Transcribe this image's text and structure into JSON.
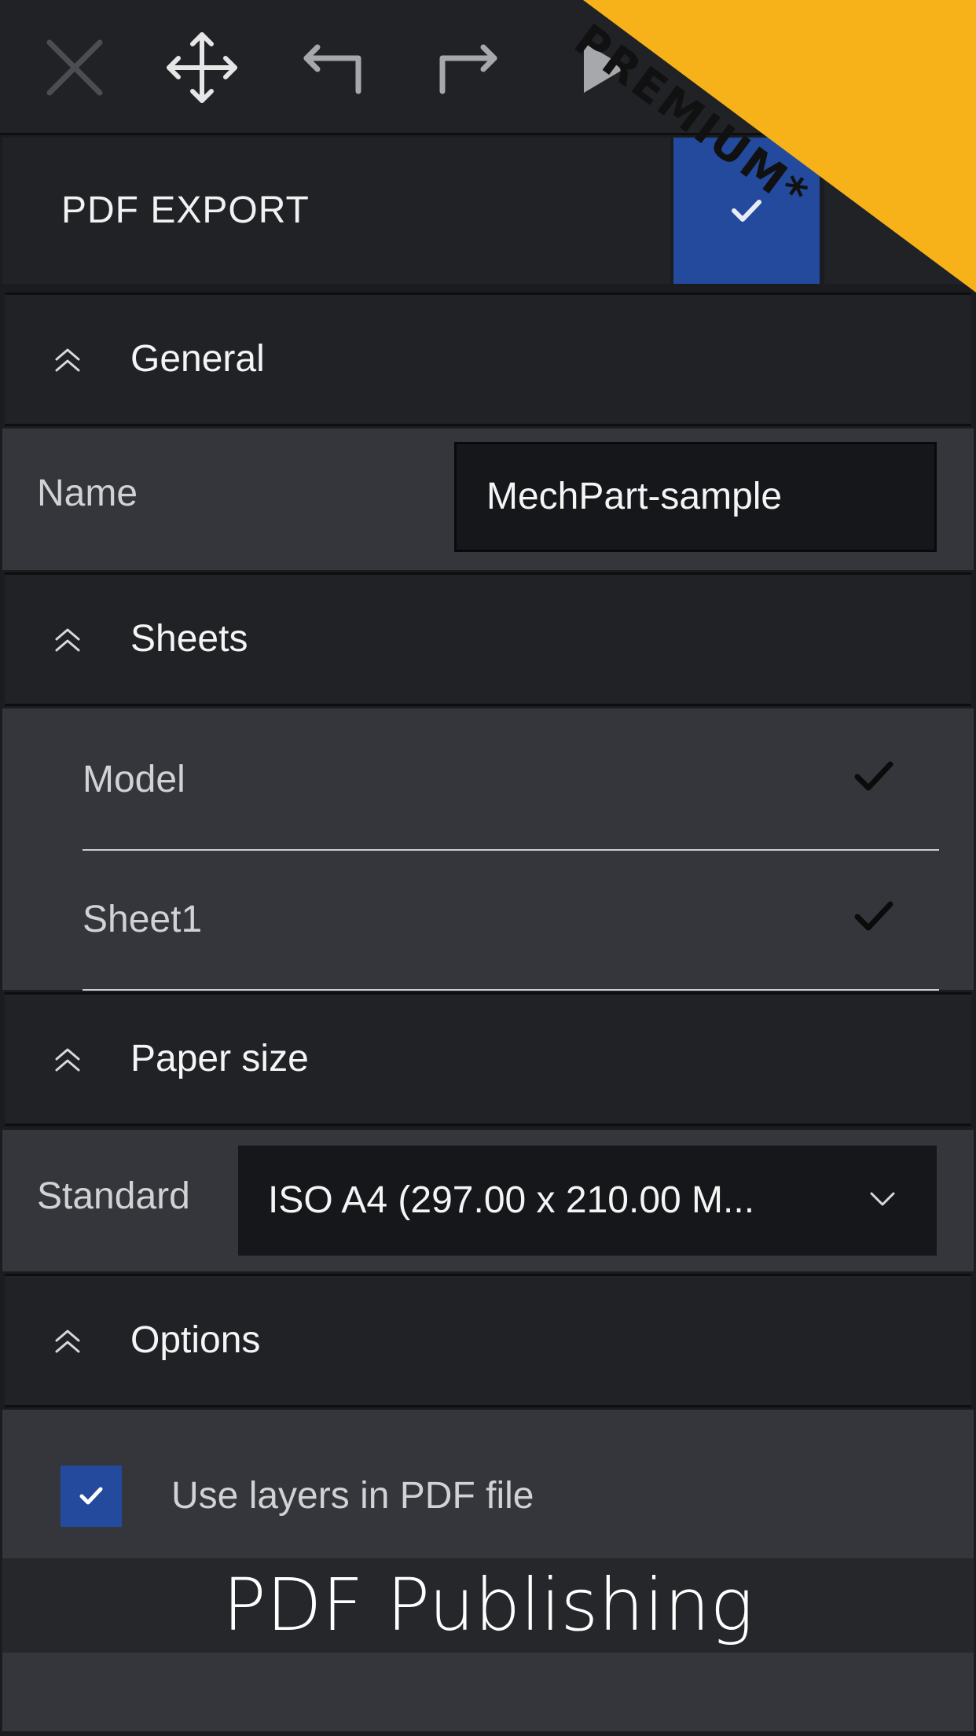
{
  "toolbar": {
    "icons": [
      "close-icon",
      "move-icon",
      "undo-icon",
      "redo-icon",
      "play-icon"
    ]
  },
  "ribbon": {
    "text": "PREMIUM*",
    "color": "#f7b21a"
  },
  "header": {
    "title": "PDF EXPORT"
  },
  "sections": {
    "general": {
      "label": "General"
    },
    "sheets": {
      "label": "Sheets"
    },
    "paper_size": {
      "label": "Paper size"
    },
    "options": {
      "label": "Options"
    }
  },
  "general": {
    "name_label": "Name",
    "name_value": "MechPart-sample"
  },
  "sheets": {
    "items": [
      {
        "label": "Model",
        "checked": true
      },
      {
        "label": "Sheet1",
        "checked": true
      }
    ]
  },
  "paper": {
    "standard_label": "Standard",
    "standard_value": "ISO A4 (297.00 x 210.00 M..."
  },
  "options": {
    "use_layers_label": "Use layers in PDF file",
    "use_layers_checked": true
  },
  "caption": {
    "text": "PDF Publishing"
  },
  "colors": {
    "accent": "#234a9c",
    "panel": "#34363b",
    "header": "#202226"
  }
}
